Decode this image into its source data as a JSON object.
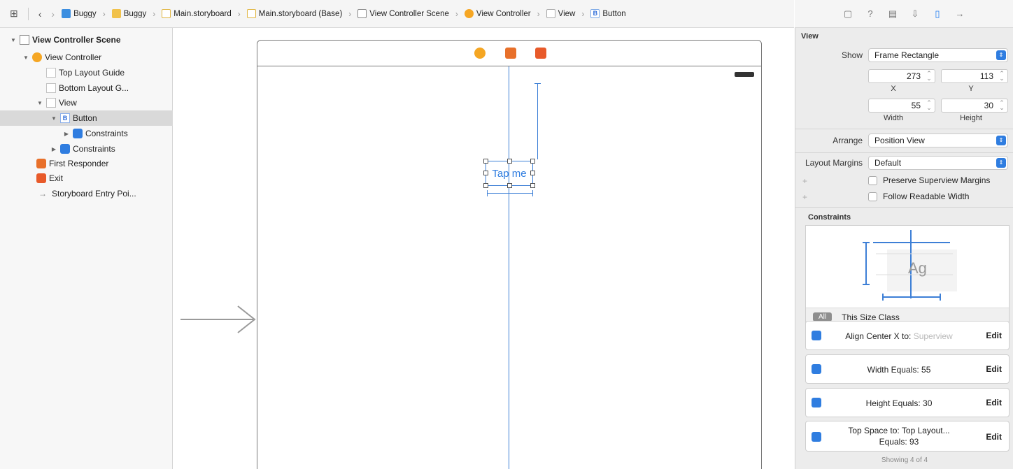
{
  "jumpbar": {
    "crumbs": [
      "Buggy",
      "Buggy",
      "Main.storyboard",
      "Main.storyboard (Base)",
      "View Controller Scene",
      "View Controller",
      "View",
      "Button"
    ]
  },
  "outline": {
    "items": [
      {
        "label": "View Controller Scene",
        "icon": "scene-icon"
      },
      {
        "label": "View Controller",
        "icon": "view-controller-icon"
      },
      {
        "label": "Top Layout Guide",
        "icon": "layout-guide-icon"
      },
      {
        "label": "Bottom Layout G...",
        "icon": "layout-guide-icon"
      },
      {
        "label": "View",
        "icon": "view-icon"
      },
      {
        "label": "Button",
        "icon": "button-icon",
        "badge": "B"
      },
      {
        "label": "Constraints",
        "icon": "constraints-icon"
      },
      {
        "label": "Constraints",
        "icon": "constraints-icon"
      },
      {
        "label": "First Responder",
        "icon": "first-responder-icon"
      },
      {
        "label": "Exit",
        "icon": "exit-icon"
      },
      {
        "label": "Storyboard Entry Poi...",
        "icon": "entry-arrow-icon"
      }
    ]
  },
  "canvas": {
    "button_title": "Tap me"
  },
  "inspector": {
    "section_view": "View",
    "show_label": "Show",
    "show_value": "Frame Rectangle",
    "x_value": "273",
    "y_value": "113",
    "x_caption": "X",
    "y_caption": "Y",
    "width_value": "55",
    "height_value": "30",
    "width_caption": "Width",
    "height_caption": "Height",
    "arrange_label": "Arrange",
    "arrange_value": "Position View",
    "layout_margins_label": "Layout Margins",
    "layout_margins_value": "Default",
    "preserve_label": "Preserve Superview Margins",
    "follow_label": "Follow Readable Width",
    "constraints_title": "Constraints",
    "editor_sample": "Ag",
    "size_class_pill": "All",
    "size_class_label": "This Size Class",
    "constraints": [
      {
        "line1": "Align Center X to:",
        "line1_muted": "Superview",
        "line2": "",
        "edit": "Edit"
      },
      {
        "line1": "Width Equals:",
        "line1_value": "55",
        "line2": "",
        "edit": "Edit"
      },
      {
        "line1": "Height Equals:",
        "line1_value": "30",
        "line2": "",
        "edit": "Edit"
      },
      {
        "line1": "Top Space to:",
        "line1_value": "Top Layout...",
        "line2": "Equals:",
        "line2_value": "93",
        "edit": "Edit"
      }
    ],
    "showing": "Showing 4 of 4",
    "accent": "#2f7de0"
  }
}
